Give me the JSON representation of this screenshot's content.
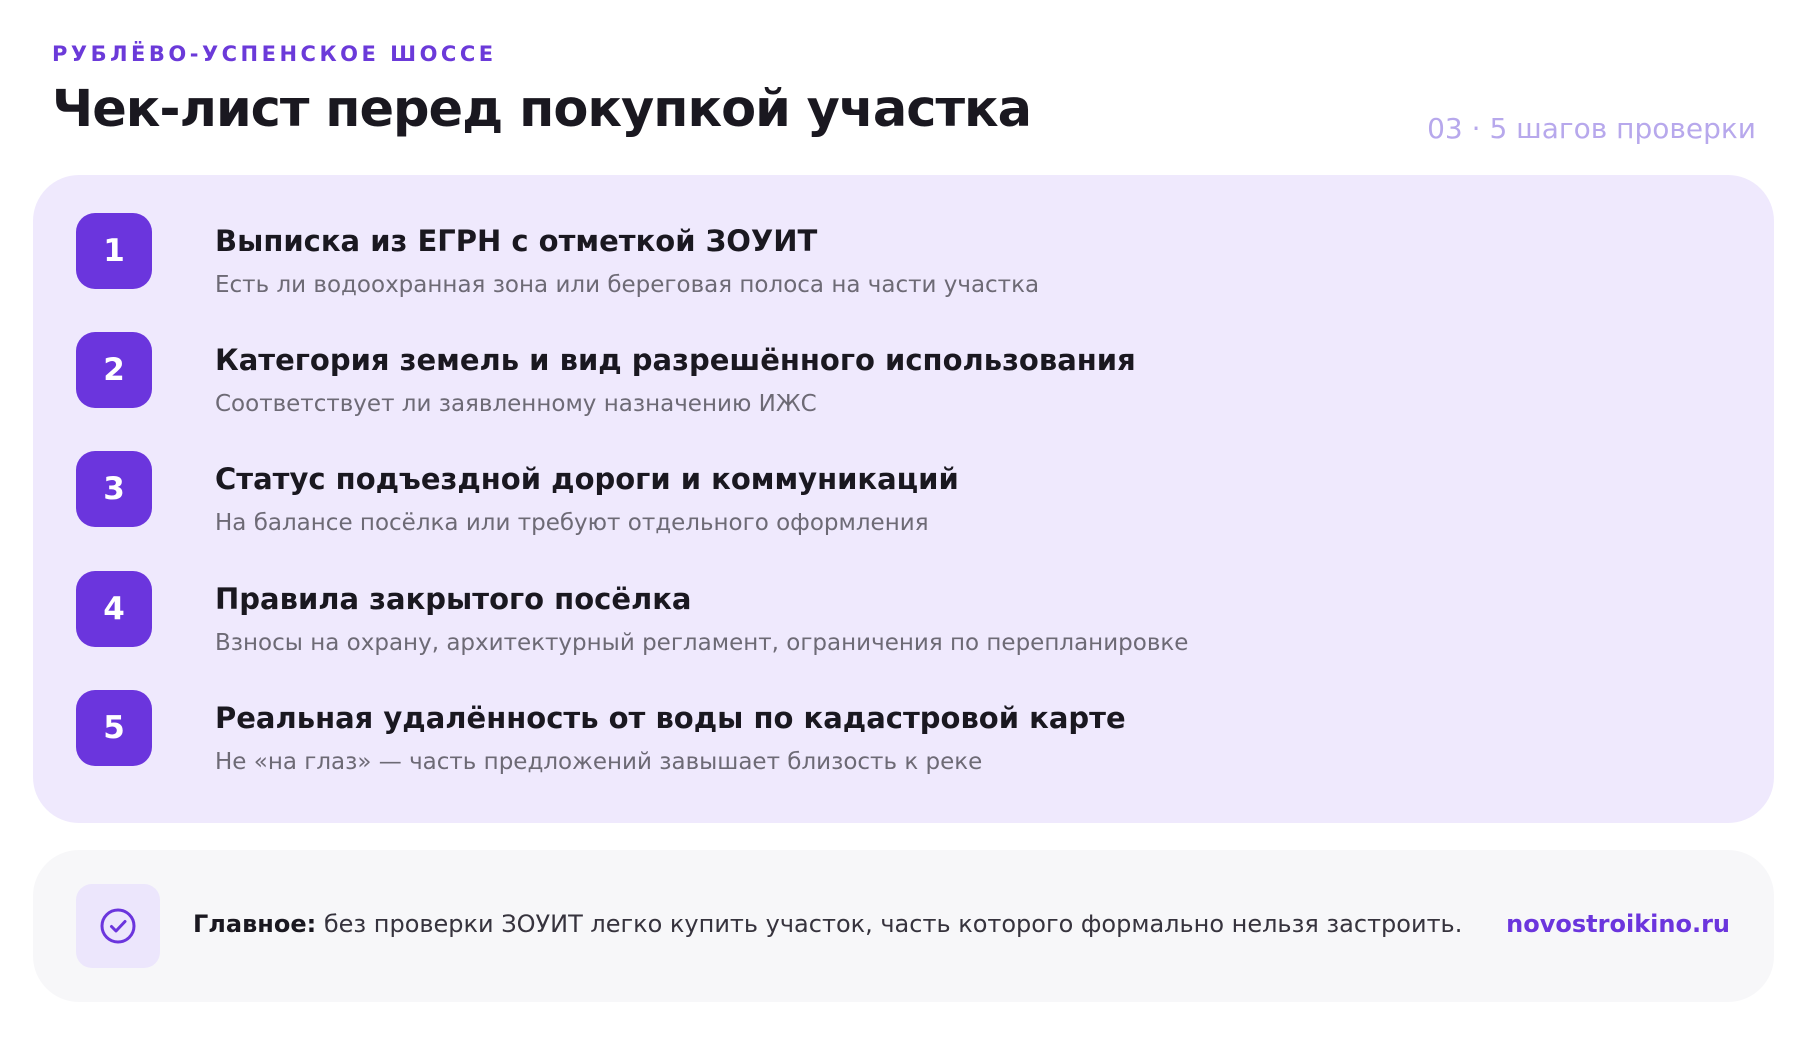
{
  "header": {
    "kicker": "РУБЛЁВО-УСПЕНСКОЕ ШОССЕ",
    "title": "Чек-лист перед покупкой участка",
    "meta": "03 · 5 шагов проверки"
  },
  "steps": [
    {
      "number": "1",
      "title": "Выписка из ЕГРН с отметкой ЗОУИТ",
      "description": "Есть ли водоохранная зона или береговая полоса на части участка"
    },
    {
      "number": "2",
      "title": "Категория земель и вид разрешённого использования",
      "description": "Соответствует ли заявленному назначению ИЖС"
    },
    {
      "number": "3",
      "title": "Статус подъездной дороги и коммуникаций",
      "description": "На балансе посёлка или требуют отдельного оформления"
    },
    {
      "number": "4",
      "title": "Правила закрытого посёлка",
      "description": "Взносы на охрану, архитектурный регламент, ограничения по перепланировке"
    },
    {
      "number": "5",
      "title": "Реальная удалённость от воды по кадастровой карте",
      "description": "Не «на глаз» — часть предложений завышает близость к реке"
    }
  ],
  "note": {
    "icon": "check-circle-icon",
    "label": "Главное:",
    "text": " без проверки ЗОУИТ легко купить участок, часть которого формально нельзя застроить.",
    "link": "novostroikino.ru"
  },
  "colors": {
    "accent": "#6b35dd",
    "panel": "#efe9fd",
    "meta": "#b7a8ec",
    "muted": "#6d6a75"
  }
}
